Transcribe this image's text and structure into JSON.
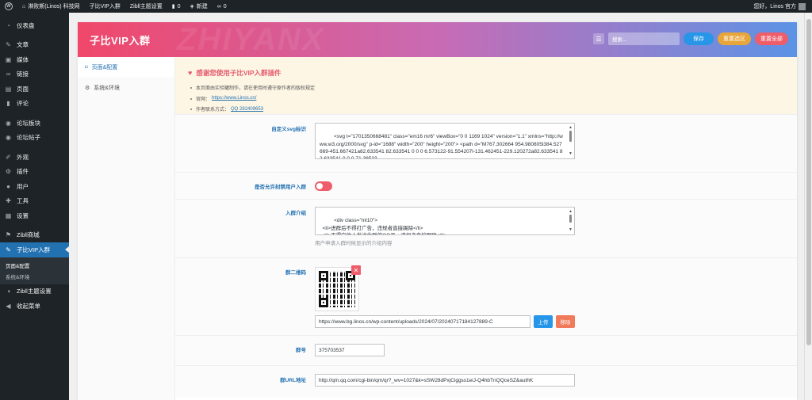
{
  "adminbar": {
    "site_name": "淋败斯(Linos) 科技网",
    "plugin_menu": "子比VIP入群",
    "theme_settings": "Zibll主题设置",
    "comments_count": "0",
    "new_label": "新建",
    "links_count": "0",
    "greeting": "您好，Linos 官方"
  },
  "sidebar": {
    "items": [
      {
        "label": "仪表盘",
        "icon": "dashboard-icon"
      },
      {
        "label": "文章",
        "icon": "pin-icon"
      },
      {
        "label": "媒体",
        "icon": "media-icon"
      },
      {
        "label": "链接",
        "icon": "link-icon"
      },
      {
        "label": "页面",
        "icon": "page-icon"
      },
      {
        "label": "评论",
        "icon": "comment-icon"
      },
      {
        "label": "论坛板块",
        "icon": "forum-icon"
      },
      {
        "label": "论坛帖子",
        "icon": "forum-post-icon"
      },
      {
        "label": "外观",
        "icon": "brush-icon"
      },
      {
        "label": "插件",
        "icon": "plugin-icon"
      },
      {
        "label": "用户",
        "icon": "user-icon"
      },
      {
        "label": "工具",
        "icon": "wrench-icon"
      },
      {
        "label": "设置",
        "icon": "settings-icon"
      },
      {
        "label": "Zibll商城",
        "icon": "shop-icon"
      },
      {
        "label": "子比VIP入群",
        "icon": "vip-icon"
      },
      {
        "label": "Zibll主题设置",
        "icon": "theme-icon"
      },
      {
        "label": "收起菜单",
        "icon": "collapse-icon"
      }
    ],
    "submenu": [
      "页面&配置",
      "系统&环境"
    ]
  },
  "header": {
    "title": "子比VIP入群",
    "search_placeholder": "搜索...",
    "save": "保存",
    "reset_section": "重置选区",
    "reset_all": "重置全部"
  },
  "leftnav": [
    "页面&配置",
    "系统&环境"
  ],
  "notice": {
    "heading": "感谢您使用子比VIP入群插件",
    "line1": "本页面由实验罐制作，请在使用时遵守原作者的版权规定",
    "line2_prefix": "官网：",
    "line2_link": "https://www.Linos.cn/",
    "line3_prefix": "作者联系方式：",
    "line3_link": "QQ 282409653"
  },
  "fields": {
    "svg_label": "自定义svg标识",
    "svg_value": "<svg t=\"1701350668481\" class=\"em16 mr6\" viewBox=\"0 0 1169 1024\" version=\"1.1\" xmlns=\"http://www.w3.org/2000/svg\" p-id=\"1688\" width=\"200\" height=\"200\"> <path d=\"M767.302664 954.980805l384.527669-451.667421a82.633541 82.633541 0 0 0 6.573122-91.554207l-131.462451-229.120272a82.633541 82.633541 0 0 0-71.36533-",
    "ban_label": "是否允许封禁用户入群",
    "intro_label": "入群介绍",
    "intro_value": "<div class=\"ml10\">\n  <li>进群后不得打广告，违规者直接踢除</li>\n  <li>不得向他人发送此群的QQ号，违规者直接踢除</li>",
    "intro_hint": "用户申请入群时候显示的介绍内容",
    "qr_label": "群二维码",
    "qr_url": "https://www.bg.linos.cn/wp-content/uploads/2024/07/20240717184127889-C",
    "upload": "上传",
    "remove": "移除",
    "group_no_label": "群号",
    "group_no": "375703537",
    "group_url_label": "群URL地址",
    "group_url": "http://qm.qq.com/cgi-bin/qm/qr?_wv=1027&k=sSW28dPxjCiggss1eiJ-Q4hbTnQQceSZ&authK"
  },
  "colors": {
    "accent": "#2271b1",
    "danger": "#ef5d6a"
  }
}
